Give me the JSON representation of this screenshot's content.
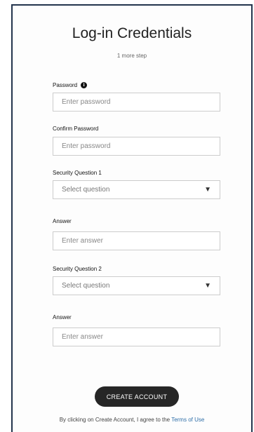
{
  "header": {
    "title": "Log-in Credentials",
    "subtitle": "1 more step"
  },
  "fields": {
    "password": {
      "label": "Password",
      "placeholder": "Enter password",
      "info_icon": "info-icon"
    },
    "confirm_password": {
      "label": "Confirm Password",
      "placeholder": "Enter password"
    },
    "security_question_1": {
      "label": "Security Question 1",
      "selected": "Select question",
      "icon": "caret-down-icon"
    },
    "answer_1": {
      "label": "Answer",
      "placeholder": "Enter answer"
    },
    "security_question_2": {
      "label": "Security Question 2",
      "selected": "Select question",
      "icon": "caret-down-icon"
    },
    "answer_2": {
      "label": "Answer",
      "placeholder": "Enter answer"
    }
  },
  "actions": {
    "create_account_label": "CREATE ACCOUNT"
  },
  "footer": {
    "agreement_text": "By clicking on Create Account, I agree to the ",
    "terms_link_text": "Terms of Use"
  },
  "colors": {
    "frame_border": "#23344d",
    "button_bg": "#262626",
    "link": "#2f6fa8"
  }
}
